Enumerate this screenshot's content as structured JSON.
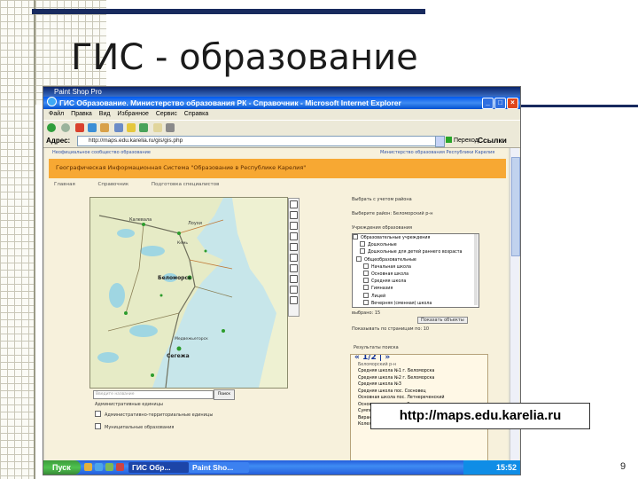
{
  "slide": {
    "title": "ГИС - образование",
    "page_number": "9",
    "url_caption": "http://maps.edu.karelia.ru"
  },
  "paint_window": {
    "title": "Paint Shop Pro"
  },
  "browser": {
    "title": "ГИС Образование. Министерство образования РК - Справочник - Microsoft Internet Explorer",
    "menu": [
      "Файл",
      "Правка",
      "Вид",
      "Избранное",
      "Сервис",
      "Справка"
    ],
    "address_label": "Адрес:",
    "address_value": "http://maps.edu.karelia.ru/gis/gis.php",
    "go_label": "Переход",
    "links_label": "Ссылки"
  },
  "web_page": {
    "top_left_link": "Неофициальное сообщество образование",
    "top_right_link": "Министерство образования Республики Карелия",
    "header": "Географическая Информационная Система \"Образование в Республике Карелия\"",
    "tabs": [
      "Главная",
      "Справочник",
      "Подготовка специалистов"
    ],
    "search_placeholder": "Введите название",
    "search_button": "Поиск",
    "layers_label": "Административные единицы",
    "layer_options": [
      "Административно-территориальные единицы",
      "Муниципальные образования"
    ],
    "map_labels": [
      "Калевала",
      "Лоухи",
      "Беломорск",
      "Сегежа",
      "Медвежьегорск",
      "Кемь"
    ],
    "right_panel": {
      "district_select": "Выбрать с учетом района",
      "district_hint": "Выберите район: Беломорский р-н",
      "type_label": "Учреждения образования",
      "tree_items": [
        "Образовательные учреждения",
        "Дошкольные",
        "Дошкольные для детей раннего возраста",
        "Общеобразовательные",
        "Начальная школа",
        "Основная школа",
        "Средняя школа",
        "Гимназия",
        "Лицей",
        "Вечерняя (сменная) школа"
      ],
      "selected_label": "выбрано: 15",
      "show_button": "Показать объекты",
      "per_page_label": "Показывать по страницам по: 10",
      "results_header": "Результаты поиска",
      "pager": "« 1/2 | »",
      "district_result": "Беломорский р-н",
      "results": [
        "Средняя школа №1 г. Беломорска",
        "Средняя школа №2 г. Беломорска",
        "Средняя школа №3",
        "Средняя школа пос. Сосновец",
        "Основная школа пос. Летнереченский",
        "Основная школа пос. Золотец",
        "Сумпосадская основная школа",
        "Вирандозерская основная школа",
        "Колежемская основная школа"
      ]
    }
  },
  "taskbar": {
    "start_label": "Пуск",
    "tasks": [
      "ГИС Обр...",
      "Paint Sho..."
    ],
    "clock": "15:52"
  },
  "colors": {
    "accent_navy": "#182a5e",
    "ie_blue": "#0058ee",
    "orange_header": "#f7a833",
    "start_green": "#3c9a3c",
    "map_water": "#c7e6ea"
  },
  "icons": [
    "search-icon",
    "zoom-in-icon",
    "zoom-out-icon",
    "pan-icon",
    "print-icon",
    "refresh-icon"
  ]
}
